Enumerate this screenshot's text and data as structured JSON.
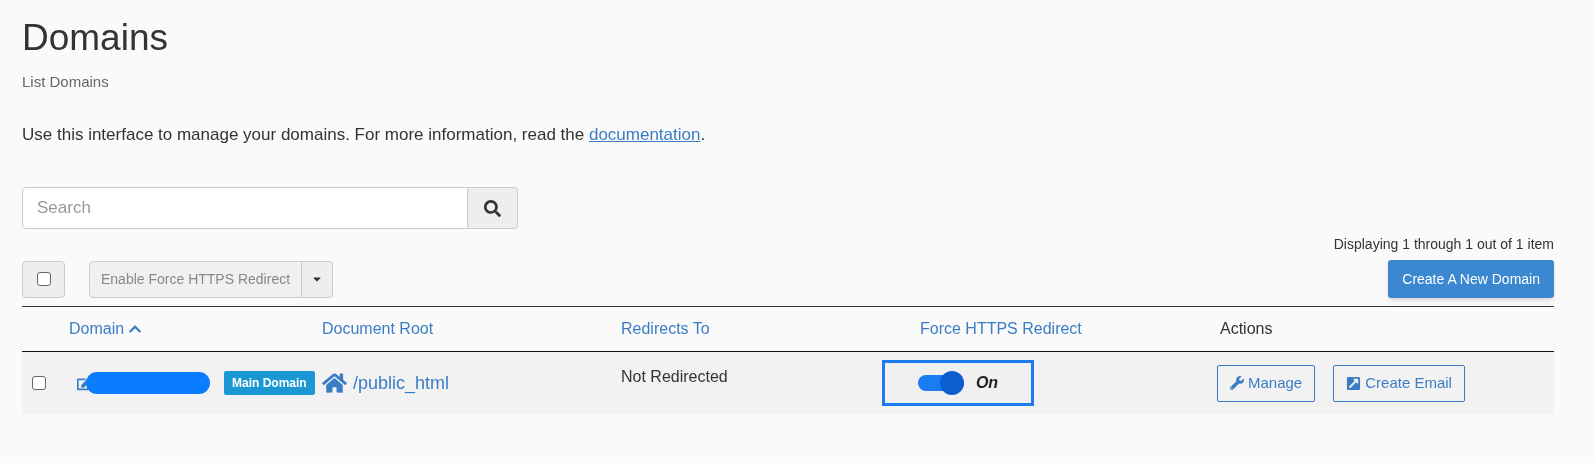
{
  "page": {
    "title": "Domains",
    "subtitle": "List Domains",
    "intro": {
      "before": "Use this interface to manage your domains. For more information, read the ",
      "link": "documentation",
      "after": "."
    }
  },
  "search": {
    "placeholder": "Search"
  },
  "pagination": "Displaying 1 through 1 out of 1 item",
  "toolbar": {
    "select_all_checked": false,
    "bulk_action": {
      "label": "Enable Force HTTPS Redirect",
      "disabled": true
    },
    "create_button": "Create A New Domain"
  },
  "table": {
    "columns": [
      {
        "label": "Domain",
        "sorted": true
      },
      {
        "label": "Document Root",
        "sorted": false
      },
      {
        "label": "Redirects To",
        "sorted": false
      },
      {
        "label": "Force HTTPS Redirect",
        "sorted": false
      },
      {
        "label": "Actions",
        "sorted": false
      }
    ],
    "rows": [
      {
        "checked": false,
        "badge": "Main Domain",
        "document_root": "/public_html",
        "redirects_to": "Not Redirected",
        "force_https": {
          "on": true,
          "label": "On"
        },
        "actions": [
          "Manage",
          "Create Email"
        ]
      }
    ]
  }
}
